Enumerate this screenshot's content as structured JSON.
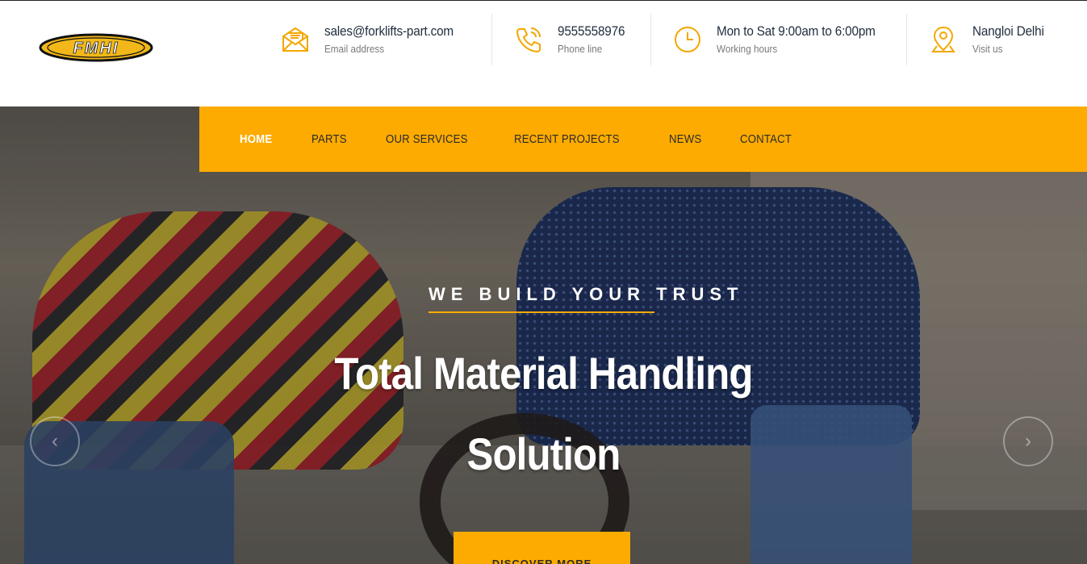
{
  "brand": {
    "logo_text": "FMHI",
    "accent": "#fdab00"
  },
  "contact": [
    {
      "icon": "envelope-icon",
      "main": "sales@forklifts-part.com",
      "sub": "Email address"
    },
    {
      "icon": "phone-icon",
      "main": "9555558976",
      "sub": "Phone line"
    },
    {
      "icon": "clock-icon",
      "main": "Mon to Sat 9:00am to 6:00pm",
      "sub": "Working hours"
    },
    {
      "icon": "location-pin-icon",
      "main": "Nangloi Delhi",
      "sub": "Visit us"
    }
  ],
  "nav": {
    "items": [
      "HOME",
      "PARTS",
      "OUR SERVICES",
      "RECENT PROJECTS",
      "NEWS",
      "CONTACT"
    ],
    "active": "HOME"
  },
  "hero": {
    "eyebrow": "WE BUILD YOUR TRUST",
    "headline_line1": "Total Material Handling",
    "headline_line2": "Solution",
    "cta_label": "DISCOVER MORE",
    "prev_icon": "chevron-left-icon",
    "next_icon": "chevron-right-icon"
  }
}
